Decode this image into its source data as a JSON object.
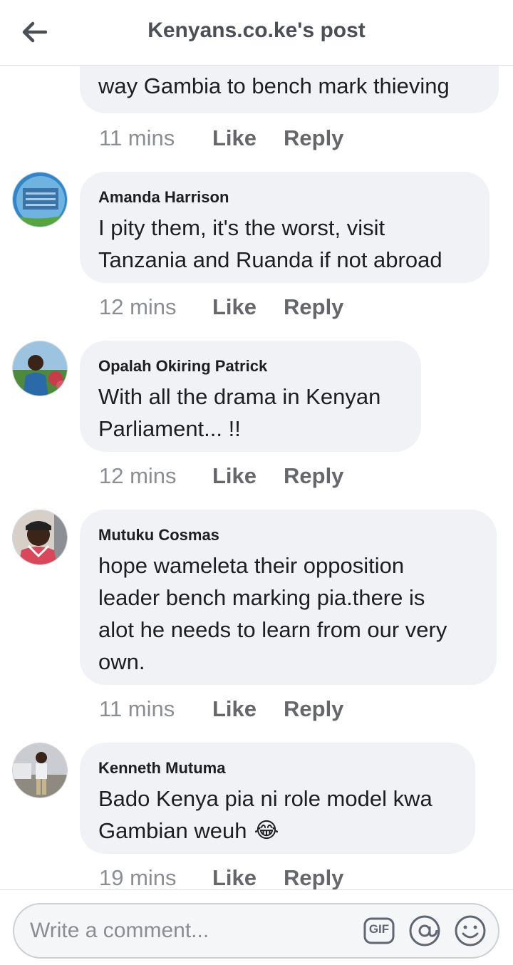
{
  "header": {
    "title": "Kenyans.co.ke's post",
    "back_icon": "arrow-left-icon"
  },
  "partial_comment": {
    "text": "way Gambia to bench mark thieving",
    "time": "11 mins",
    "like": "Like",
    "reply": "Reply"
  },
  "comments": [
    {
      "author": "Amanda Harrison",
      "lines": [
        "I pity them, it's the worst, visit",
        "Tanzania and Ruanda if not abroad"
      ],
      "time": "12 mins",
      "like": "Like",
      "reply": "Reply"
    },
    {
      "author": "Opalah Okiring Patrick",
      "lines": [
        "With all the drama in Kenyan",
        "Parliament... !!"
      ],
      "time": "12 mins",
      "like": "Like",
      "reply": "Reply"
    },
    {
      "author": "Mutuku Cosmas",
      "lines": [
        "hope wameleta their opposition",
        "leader bench marking pia.there is",
        "alot he needs to learn from our very",
        "own."
      ],
      "time": "11 mins",
      "like": "Like",
      "reply": "Reply"
    },
    {
      "author": "Kenneth Mutuma",
      "lines": [
        "Bado Kenya pia ni role model kwa",
        "Gambian weuh"
      ],
      "emoji": "😂",
      "time": "19 mins",
      "like": "Like",
      "reply": "Reply"
    }
  ],
  "composer": {
    "placeholder": "Write a comment...",
    "gif_label": "GIF",
    "icons": [
      "gif-icon",
      "mention-icon",
      "emoji-icon"
    ]
  },
  "colors": {
    "bubble": "#f0f2f5",
    "meta_time": "#8a8d91",
    "meta_action": "#65676b",
    "title": "#4b4f56"
  }
}
